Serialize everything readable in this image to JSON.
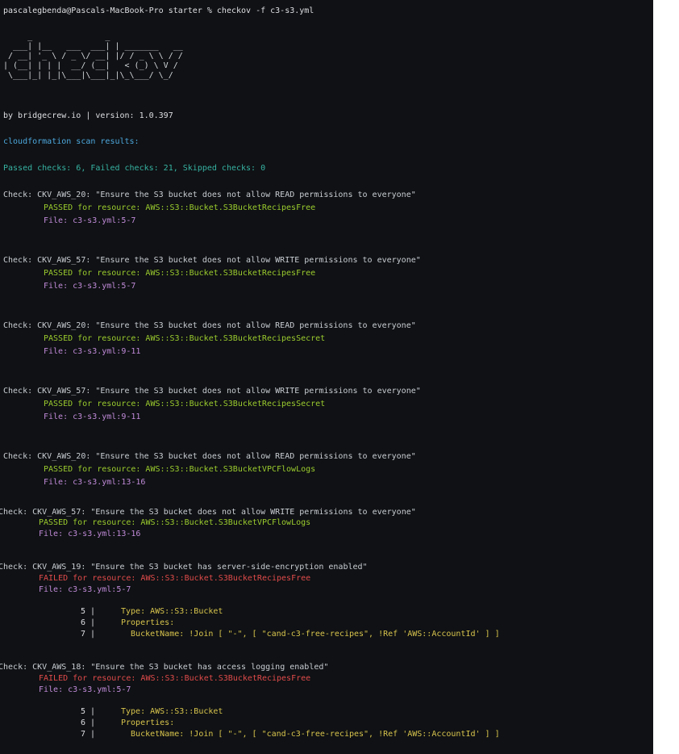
{
  "prompt": "pascalegbenda@Pascals-MacBook-Pro starter % checkov -f c3-s3.yml",
  "ascii_logo": "     _               _\n  ___| |__   ___  ___| | _______   __\n / __| '_ \\ / _ \\/ __| |/ / _ \\ \\ / /\n| (__| | | |  __/ (__|   < (_) \\ V /\n \\___|_| |_|\\___|\\___|_|\\_\\___/ \\_/",
  "version_line": "by bridgecrew.io | version: 1.0.397",
  "scan_header": "cloudformation scan results:",
  "summary": "Passed checks: 6, Failed checks: 21, Skipped checks: 0",
  "checks": [
    {
      "check": "Check: CKV_AWS_20: \"Ensure the S3 bucket does not allow READ permissions to everyone\"",
      "result": "PASSED for resource: AWS::S3::Bucket.S3BucketRecipesFree",
      "file": "File: c3-s3.yml:5-7"
    },
    {
      "check": "Check: CKV_AWS_57: \"Ensure the S3 bucket does not allow WRITE permissions to everyone\"",
      "result": "PASSED for resource: AWS::S3::Bucket.S3BucketRecipesFree",
      "file": "File: c3-s3.yml:5-7"
    },
    {
      "check": "Check: CKV_AWS_20: \"Ensure the S3 bucket does not allow READ permissions to everyone\"",
      "result": "PASSED for resource: AWS::S3::Bucket.S3BucketRecipesSecret",
      "file": "File: c3-s3.yml:9-11"
    },
    {
      "check": "Check: CKV_AWS_57: \"Ensure the S3 bucket does not allow WRITE permissions to everyone\"",
      "result": "PASSED for resource: AWS::S3::Bucket.S3BucketRecipesSecret",
      "file": "File: c3-s3.yml:9-11"
    },
    {
      "check": "Check: CKV_AWS_20: \"Ensure the S3 bucket does not allow READ permissions to everyone\"",
      "result": "PASSED for resource: AWS::S3::Bucket.S3BucketVPCFlowLogs",
      "file": "File: c3-s3.yml:13-16"
    },
    {
      "check": "Check: CKV_AWS_57: \"Ensure the S3 bucket does not allow WRITE permissions to everyone\"",
      "result": "PASSED for resource: AWS::S3::Bucket.S3BucketVPCFlowLogs",
      "file": "File: c3-s3.yml:13-16"
    },
    {
      "check": "Check: CKV_AWS_19: \"Ensure the S3 bucket has server-side-encryption enabled\"",
      "result": "FAILED for resource: AWS::S3::Bucket.S3BucketRecipesFree",
      "file": "File: c3-s3.yml:5-7",
      "code": [
        {
          "num": "5 |",
          "text": "Type: AWS::S3::Bucket"
        },
        {
          "num": "6 |",
          "text": "Properties:"
        },
        {
          "num": "7 |",
          "text": "  BucketName: !Join [ \"-\", [ \"cand-c3-free-recipes\", !Ref 'AWS::AccountId' ] ]"
        }
      ]
    },
    {
      "check": "Check: CKV_AWS_18: \"Ensure the S3 bucket has access logging enabled\"",
      "result": "FAILED for resource: AWS::S3::Bucket.S3BucketRecipesFree",
      "file": "File: c3-s3.yml:5-7",
      "code": [
        {
          "num": "5 |",
          "text": "Type: AWS::S3::Bucket"
        },
        {
          "num": "6 |",
          "text": "Properties:"
        },
        {
          "num": "7 |",
          "text": "  BucketName: !Join [ \"-\", [ \"cand-c3-free-recipes\", !Ref 'AWS::AccountId' ] ]"
        }
      ]
    }
  ]
}
